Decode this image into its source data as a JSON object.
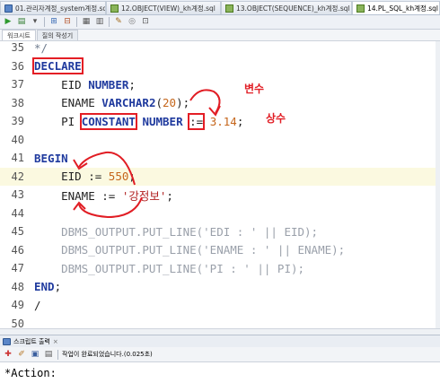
{
  "tabs": [
    {
      "label": "01.관리자계정_system계정.sql",
      "icon": "sql-file-icon",
      "active": false
    },
    {
      "label": "12.OBJECT(VIEW)_kh계정.sql",
      "icon": "grid-icon",
      "active": false
    },
    {
      "label": "13.OBJECT(SEQUENCE)_kh계정.sql",
      "icon": "grid-icon",
      "active": false
    },
    {
      "label": "14.PL_SQL_kh계정.sql",
      "icon": "grid-icon",
      "active": true
    }
  ],
  "subtabs": [
    "워크시트",
    "질의 작성기"
  ],
  "editor": {
    "lines": [
      {
        "n": "35",
        "parts": [
          {
            "t": "*/",
            "c": "cmt"
          }
        ]
      },
      {
        "n": "36",
        "parts": [
          {
            "t": "DECLARE",
            "c": "kw box"
          }
        ]
      },
      {
        "n": "37",
        "parts": [
          {
            "t": "    EID ",
            "c": "plain"
          },
          {
            "t": "NUMBER",
            "c": "kw"
          },
          {
            "t": ";",
            "c": "plain"
          }
        ]
      },
      {
        "n": "38",
        "parts": [
          {
            "t": "    ENAME ",
            "c": "plain"
          },
          {
            "t": "VARCHAR2",
            "c": "kw"
          },
          {
            "t": "(",
            "c": "plain"
          },
          {
            "t": "20",
            "c": "num"
          },
          {
            "t": ");",
            "c": "plain"
          }
        ]
      },
      {
        "n": "39",
        "parts": [
          {
            "t": "    PI ",
            "c": "plain"
          },
          {
            "t": "CONSTANT",
            "c": "kw box"
          },
          {
            "t": " ",
            "c": "plain"
          },
          {
            "t": "NUMBER",
            "c": "kw"
          },
          {
            "t": " ",
            "c": "plain"
          },
          {
            "t": ":=",
            "c": "plain box"
          },
          {
            "t": " ",
            "c": "plain"
          },
          {
            "t": "3.14",
            "c": "num"
          },
          {
            "t": ";",
            "c": "plain"
          }
        ]
      },
      {
        "n": "40",
        "parts": []
      },
      {
        "n": "41",
        "parts": [
          {
            "t": "BEGIN",
            "c": "kw"
          }
        ]
      },
      {
        "n": "42",
        "parts": [
          {
            "t": "    EID := ",
            "c": "plain"
          },
          {
            "t": "550",
            "c": "num"
          },
          {
            "t": ";",
            "c": "plain"
          }
        ],
        "current": true
      },
      {
        "n": "43",
        "parts": [
          {
            "t": "    ENAME := ",
            "c": "plain"
          },
          {
            "t": "'강정보'",
            "c": "str"
          },
          {
            "t": ";",
            "c": "plain"
          }
        ]
      },
      {
        "n": "44",
        "parts": []
      },
      {
        "n": "45",
        "parts": [
          {
            "t": "    DBMS_OUTPUT.PUT_LINE('EDI : ' || EID);",
            "c": "dim"
          }
        ]
      },
      {
        "n": "46",
        "parts": [
          {
            "t": "    DBMS_OUTPUT.PUT_LINE('ENAME : ' || ENAME);",
            "c": "dim"
          }
        ]
      },
      {
        "n": "47",
        "parts": [
          {
            "t": "    DBMS_OUTPUT.PUT_LINE('PI : ' || PI);",
            "c": "dim"
          }
        ]
      },
      {
        "n": "48",
        "parts": [
          {
            "t": "END",
            "c": "kw"
          },
          {
            "t": ";",
            "c": "plain"
          }
        ]
      },
      {
        "n": "49",
        "parts": [
          {
            "t": "/",
            "c": "plain"
          }
        ]
      },
      {
        "n": "50",
        "parts": []
      }
    ]
  },
  "annotations": {
    "variable": "변수",
    "constant": "상수"
  },
  "output": {
    "tab_label": "스크립트 출력",
    "close": "×",
    "status": "작업이 완료되었습니다.(0.025초)",
    "action": "*Action:"
  }
}
